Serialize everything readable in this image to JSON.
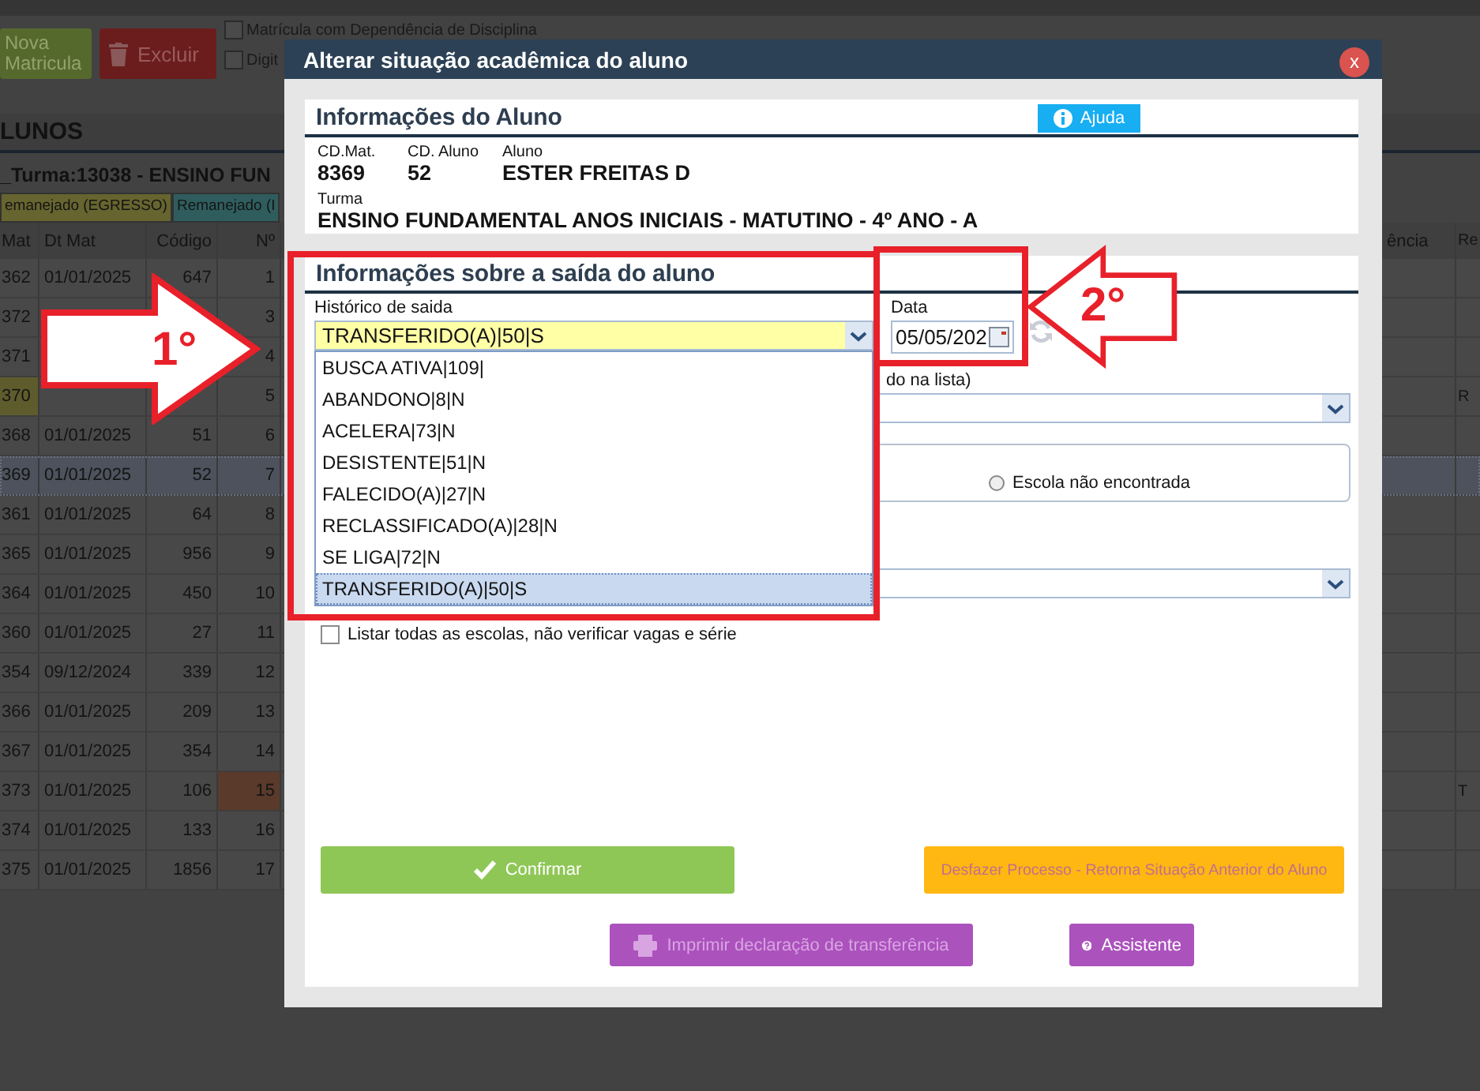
{
  "background": {
    "toolbar": {
      "buttons": [
        {
          "label": "Nova Matricula",
          "kind": "new"
        },
        {
          "label": "Excluir",
          "kind": "delete"
        }
      ],
      "checkboxes": [
        {
          "label": "Matrícula com Dependência de Disciplina",
          "checked": false
        },
        {
          "label": "Digit",
          "checked": false
        }
      ]
    },
    "section_title": "LUNOS",
    "class_title": "_Turma:13038 - ENSINO FUN",
    "legend": [
      {
        "label": "emanejado (EGRESSO)",
        "color": "#66652f"
      },
      {
        "label": "Remanejado (I",
        "color": "#2f5d5e"
      }
    ],
    "table": {
      "columns": [
        "Mat",
        "Dt Mat",
        "Código",
        "Nº",
        "ência",
        "Re"
      ],
      "rows": [
        {
          "mat": "362",
          "dt_mat": "01/01/2025",
          "codigo": "647",
          "n": "1",
          "selected": false
        },
        {
          "mat": "372",
          "n": "3",
          "selected": false
        },
        {
          "mat": "371",
          "n": "4",
          "selected": false
        },
        {
          "mat": {
            "text": "370",
            "color": "#5e5c2c"
          },
          "n": "5",
          "re": "R",
          "selected": false
        },
        {
          "mat": "368",
          "dt_mat": "01/01/2025",
          "codigo": "51",
          "n": "6",
          "selected": false
        },
        {
          "mat": "369",
          "dt_mat": "01/01/2025",
          "codigo": "52",
          "n": "7",
          "selected": true
        },
        {
          "mat": "361",
          "dt_mat": "01/01/2025",
          "codigo": "64",
          "n": "8",
          "selected": false
        },
        {
          "mat": "365",
          "dt_mat": "01/01/2025",
          "codigo": "956",
          "n": "9",
          "selected": false
        },
        {
          "mat": "364",
          "dt_mat": "01/01/2025",
          "codigo": "450",
          "n": "10",
          "selected": false
        },
        {
          "mat": "360",
          "dt_mat": "01/01/2025",
          "codigo": "27",
          "n": "11",
          "selected": false
        },
        {
          "mat": "354",
          "dt_mat": "09/12/2024",
          "codigo": "339",
          "n": "12",
          "selected": false
        },
        {
          "mat": "366",
          "dt_mat": "01/01/2025",
          "codigo": "209",
          "n": "13",
          "selected": false
        },
        {
          "mat": "367",
          "dt_mat": "01/01/2025",
          "codigo": "354",
          "n": "14",
          "selected": false
        },
        {
          "mat": "373",
          "dt_mat": "01/01/2025",
          "codigo": "106",
          "n": {
            "text": "15",
            "color": "#5a3a2b"
          },
          "re": "T",
          "selected": false
        },
        {
          "mat": "374",
          "dt_mat": "01/01/2025",
          "codigo": "133",
          "n": "16",
          "selected": false
        },
        {
          "mat": "375",
          "dt_mat": "01/01/2025",
          "codigo": "1856",
          "n": "17",
          "selected": false
        }
      ]
    }
  },
  "modal": {
    "title": "Alterar situação acadêmica do aluno",
    "close": "x",
    "student_panel": {
      "title": "Informações do Aluno",
      "help_button": "Ajuda",
      "fields": [
        {
          "label": "CD.Mat.",
          "value": "8369"
        },
        {
          "label": "CD. Aluno",
          "value": "52"
        },
        {
          "label": "Aluno",
          "value": "ESTER FREITAS D"
        }
      ],
      "class_label": "Turma",
      "class_value": "ENSINO FUNDAMENTAL ANOS INICIAIS - MATUTINO - 4º ANO - A"
    },
    "exit_panel": {
      "title": "Informações sobre a saída do aluno",
      "history": {
        "label": "Histórico de saida",
        "value": "TRANSFERIDO(A)|50|S",
        "expanded": true,
        "options": [
          {
            "label": "BUSCA ATIVA|109|",
            "selected": false
          },
          {
            "label": "ABANDONO|8|N",
            "selected": false
          },
          {
            "label": "ACELERA|73|N",
            "selected": false
          },
          {
            "label": "DESISTENTE|51|N",
            "selected": false
          },
          {
            "label": "FALECIDO(A)|27|N",
            "selected": false
          },
          {
            "label": "RECLASSIFICADO(A)|28|N",
            "selected": false
          },
          {
            "label": "SE LIGA|72|N",
            "selected": false
          },
          {
            "label": "TRANSFERIDO(A)|50|S",
            "selected": true
          }
        ]
      },
      "date": {
        "label": "Data",
        "value": "05/05/202"
      },
      "school_label": "do na lista)",
      "radio": {
        "label": "Escola não encontrada",
        "selected": false
      },
      "list_all": {
        "label": "Listar todas as escolas, não verificar vagas e série",
        "checked": false
      }
    },
    "button_rows": [
      [
        {
          "label": "Confirmar",
          "kind": "confirm",
          "disabled": false
        },
        {
          "label": "Desfazer Processo - Retorna Situação Anterior do Aluno",
          "kind": "undo",
          "disabled": true
        }
      ],
      [
        {
          "label": "Imprimir declaração de transferência",
          "kind": "print",
          "disabled": true
        },
        {
          "label": "Assistente",
          "kind": "assistant",
          "disabled": false
        }
      ]
    ]
  },
  "annotations": [
    {
      "kind": "arrow_right",
      "label": "1°"
    },
    {
      "kind": "arrow_left",
      "label": "2°"
    }
  ]
}
